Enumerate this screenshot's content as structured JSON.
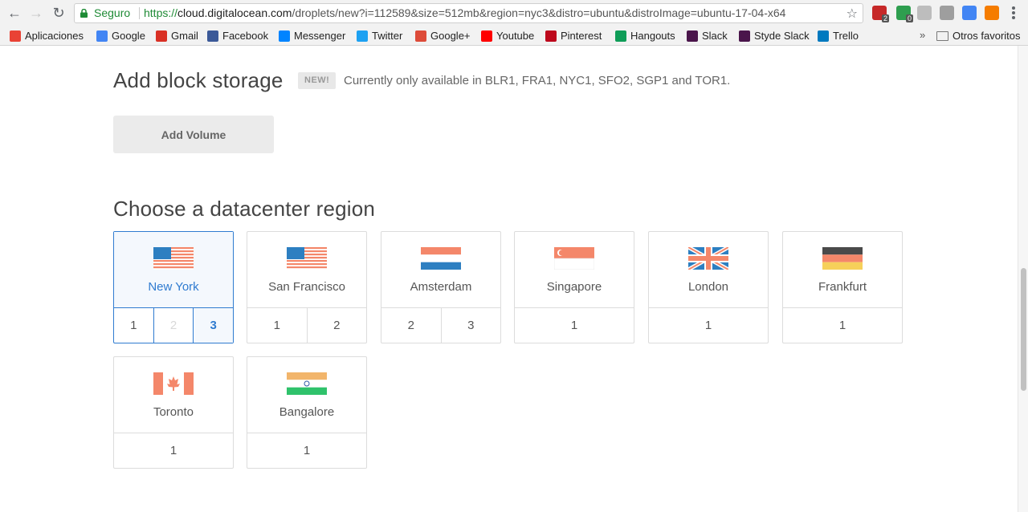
{
  "browser": {
    "secure_label": "Seguro",
    "url_scheme": "https://",
    "url_host": "cloud.digitalocean.com",
    "url_path": "/droplets/new?i=112589&size=512mb&region=nyc3&distro=ubuntu&distroImage=ubuntu-17-04-x64",
    "extensions": [
      {
        "name": "adblock-icon",
        "color": "#c62828",
        "badge": "2"
      },
      {
        "name": "extension-green-icon",
        "color": "#2e9e4f",
        "badge": "0"
      },
      {
        "name": "drive-icon",
        "color": "#bdbdbd"
      },
      {
        "name": "camera-icon",
        "color": "#9e9e9e"
      },
      {
        "name": "bookmark-ext-icon",
        "color": "#4285f4"
      },
      {
        "name": "hangouts-orange-icon",
        "color": "#f57c00"
      }
    ]
  },
  "bookmarks": [
    {
      "label": "Aplicaciones",
      "icon": "apps-grid-icon",
      "color": "#e94235"
    },
    {
      "label": "Google",
      "icon": "google-icon",
      "color": "#4285f4"
    },
    {
      "label": "Gmail",
      "icon": "gmail-icon",
      "color": "#d93025"
    },
    {
      "label": "Facebook",
      "icon": "facebook-icon",
      "color": "#3b5998"
    },
    {
      "label": "Messenger",
      "icon": "messenger-icon",
      "color": "#0084ff"
    },
    {
      "label": "Twitter",
      "icon": "twitter-icon",
      "color": "#1da1f2"
    },
    {
      "label": "Google+",
      "icon": "google-plus-icon",
      "color": "#dd4b39"
    },
    {
      "label": "Youtube",
      "icon": "youtube-icon",
      "color": "#ff0000"
    },
    {
      "label": "Pinterest",
      "icon": "pinterest-icon",
      "color": "#bd081c"
    },
    {
      "label": "Hangouts",
      "icon": "hangouts-icon",
      "color": "#0f9d58"
    },
    {
      "label": "Slack",
      "icon": "slack-icon",
      "color": "#4a154b"
    },
    {
      "label": "Styde Slack",
      "icon": "slack-icon",
      "color": "#4a154b"
    },
    {
      "label": "Trello",
      "icon": "trello-icon",
      "color": "#0079bf"
    }
  ],
  "bookmarks_more": "»",
  "other_bookmarks": "Otros favoritos",
  "block_storage": {
    "title": "Add block storage",
    "badge": "NEW!",
    "availability": "Currently only available in BLR1, FRA1, NYC1, SFO2, SGP1 and TOR1.",
    "button_label": "Add Volume"
  },
  "region": {
    "title": "Choose a datacenter region",
    "selected": "New York",
    "selected_number": "3",
    "cards": [
      {
        "name": "New York",
        "flag": "us",
        "numbers": [
          "1",
          "2",
          "3"
        ],
        "disabled": [
          "2"
        ],
        "active": "3"
      },
      {
        "name": "San Francisco",
        "flag": "us",
        "numbers": [
          "1",
          "2"
        ]
      },
      {
        "name": "Amsterdam",
        "flag": "nl",
        "numbers": [
          "2",
          "3"
        ]
      },
      {
        "name": "Singapore",
        "flag": "sg",
        "numbers": [
          "1"
        ]
      },
      {
        "name": "London",
        "flag": "uk",
        "numbers": [
          "1"
        ]
      },
      {
        "name": "Frankfurt",
        "flag": "de",
        "numbers": [
          "1"
        ]
      },
      {
        "name": "Toronto",
        "flag": "ca",
        "numbers": [
          "1"
        ]
      },
      {
        "name": "Bangalore",
        "flag": "in",
        "numbers": [
          "1"
        ]
      }
    ]
  },
  "colors": {
    "accent": "#2f7bd0",
    "secure_green": "#1f8b36",
    "flag_orange": "#f4876a",
    "flag_blue": "#2d7fc1"
  }
}
